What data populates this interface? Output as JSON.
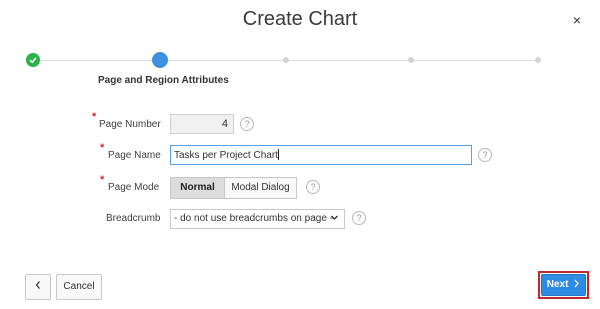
{
  "dialog": {
    "title": "Create Chart",
    "close_glyph": "×"
  },
  "wizard": {
    "current_step_label": "Page and Region Attributes",
    "steps": [
      "done",
      "current",
      "future",
      "future",
      "future"
    ]
  },
  "form": {
    "page_number": {
      "label": "Page Number",
      "value": "4",
      "required": true,
      "help": "?"
    },
    "page_name": {
      "label": "Page Name",
      "value": "Tasks per Project Chart",
      "required": true,
      "help": "?"
    },
    "page_mode": {
      "label": "Page Mode",
      "options": [
        "Normal",
        "Modal Dialog"
      ],
      "selected": "Normal",
      "required": true,
      "help": "?"
    },
    "breadcrumb": {
      "label": "Breadcrumb",
      "selected": "- do not use breadcrumbs on page -",
      "help": "?"
    }
  },
  "footer": {
    "cancel_label": "Cancel",
    "next_label": "Next"
  },
  "colors": {
    "accent": "#2e8be4",
    "success": "#2db24a",
    "required": "#d9262a",
    "highlight": "#c4272b"
  },
  "icons": {
    "complete": "check-icon",
    "close": "close-icon",
    "help": "help-icon",
    "prev": "chevron-left-icon",
    "next": "chevron-right-icon",
    "select": "chevron-down-icon"
  }
}
